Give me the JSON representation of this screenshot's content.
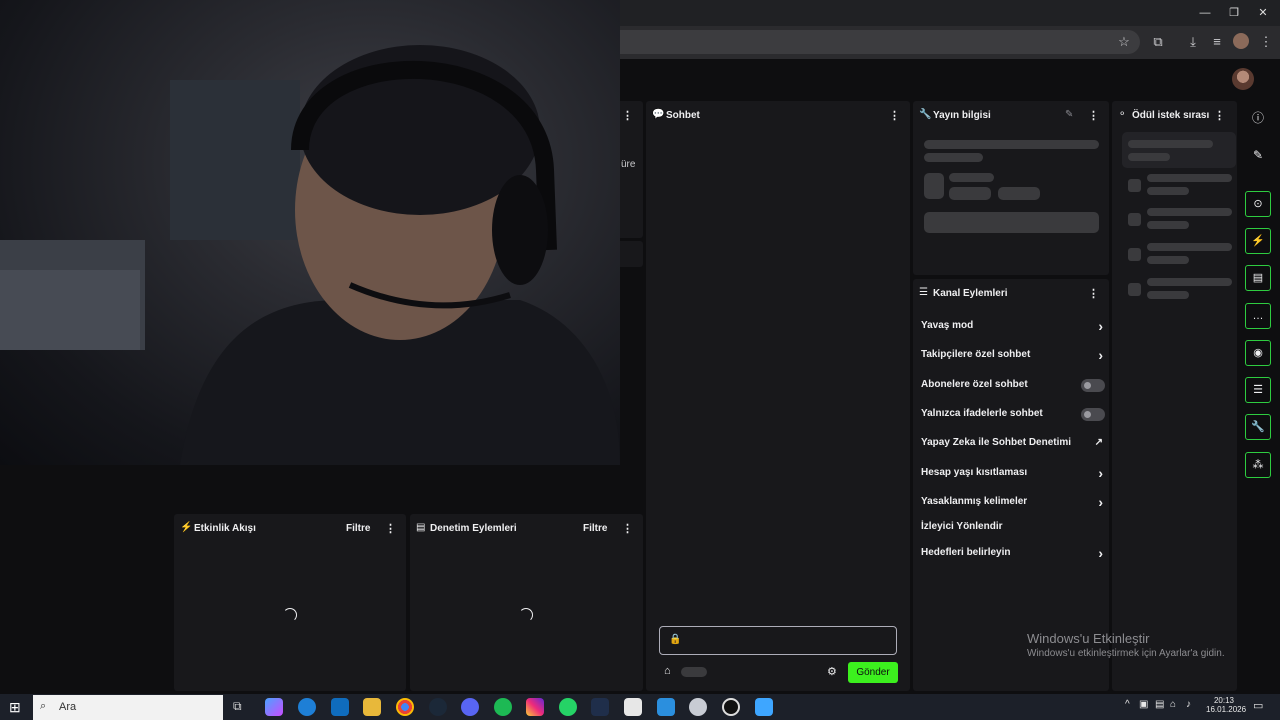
{
  "browser": {
    "window_controls": [
      "—",
      "❐",
      "✕"
    ],
    "toolbar_icons": [
      "star-icon",
      "extensions-icon",
      "download-icon",
      "reading-list-icon",
      "menu-icon"
    ]
  },
  "panels": {
    "chat": {
      "title": "Sohbet",
      "send_label": "Gönder",
      "input_placeholder": ""
    },
    "stream_info": {
      "title": "Yayın bilgisi"
    },
    "reward_queue": {
      "title": "Ödül istek sırası"
    },
    "channel_actions": {
      "title": "Kanal Eylemleri",
      "items": [
        {
          "label": "Yavaş mod",
          "control": "chevron"
        },
        {
          "label": "Takipçilere özel sohbet",
          "control": "chevron"
        },
        {
          "label": "Abonelere özel sohbet",
          "control": "toggle",
          "enabled": false
        },
        {
          "label": "Yalnızca ifadelerle sohbet",
          "control": "toggle",
          "enabled": false
        },
        {
          "label": "Yapay Zeka ile Sohbet Denetimi",
          "control": "external"
        },
        {
          "label": "Hesap yaşı kısıtlaması",
          "control": "chevron"
        },
        {
          "label": "Yasaklanmış kelimeler",
          "control": "chevron"
        },
        {
          "label": "İzleyici Yönlendir",
          "control": "none"
        },
        {
          "label": "Hedefleri belirleyin",
          "control": "chevron"
        }
      ]
    },
    "activity_feed": {
      "title": "Etkinlik Akışı",
      "filter": "Filtre"
    },
    "mod_actions": {
      "title": "Denetim Eylemleri",
      "filter": "Filtre"
    },
    "partial_left": {
      "text": "üre"
    }
  },
  "sidebar": {
    "icons": [
      "info-icon",
      "pencil-icon",
      "focus-icon",
      "lightning-icon",
      "document-icon",
      "chat-bubble-icon",
      "broadcast-icon",
      "channel-actions-icon",
      "wrench-icon",
      "reward-icon"
    ]
  },
  "watermark": {
    "line1": "Windows'u Etkinleştir",
    "line2": "Windows'u etkinleştirmek için Ayarlar'a gidin."
  },
  "taskbar": {
    "search_placeholder": "Ara",
    "time": "20:13",
    "date": "16.01.2026"
  },
  "colors": {
    "accent_green": "#3cf01e",
    "panel_bg": "#18181b",
    "page_bg": "#0e0e10"
  }
}
